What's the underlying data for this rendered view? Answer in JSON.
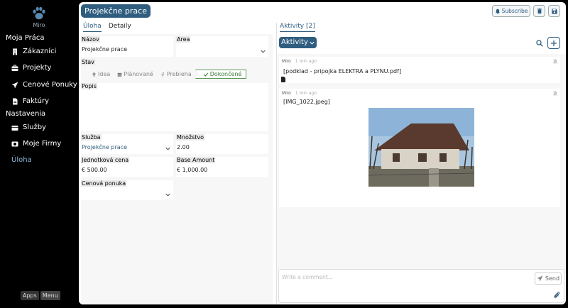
{
  "sidebar": {
    "user": "Miro",
    "section1": "Moja Práca",
    "items1": [
      {
        "label": "Zákazníci",
        "icon": "building-icon"
      },
      {
        "label": "Projekty",
        "icon": "briefcase-icon"
      },
      {
        "label": "Cenové Ponuky",
        "icon": "send-icon"
      },
      {
        "label": "Faktúry",
        "icon": "file-icon"
      }
    ],
    "section2": "Nastavenia",
    "items2": [
      {
        "label": "Služby",
        "icon": "box-icon"
      },
      {
        "label": "Moje Firmy",
        "icon": "id-card-icon"
      },
      {
        "label": "Úloha",
        "icon": ""
      }
    ],
    "apps": "Apps",
    "menu": "Menu"
  },
  "header": {
    "title": "Projekčne prace",
    "subscribe": "Subscribe"
  },
  "tabs": {
    "uloha": "Úloha",
    "detaily": "Detaily"
  },
  "form": {
    "nazov_label": "Názov",
    "nazov_value": "Projekčne prace",
    "area_label": "Area",
    "stav_label": "Stav",
    "states": [
      "Idea",
      "Plánované",
      "Prebieha",
      "Dokončené"
    ],
    "popis_label": "Popis",
    "sluzba_label": "Služba",
    "sluzba_value": "Projekčne prace",
    "mnozstvo_label": "Množstvo",
    "mnozstvo_value": "2.00",
    "cena_label": "Jednotková cena",
    "cena_value": "€ 500.00",
    "base_label": "Base Amount",
    "base_value": "€ 1,000.00",
    "ponuka_label": "Cenová ponuka"
  },
  "activity": {
    "tab": "Aktivity [2]",
    "filter": "Aktivity",
    "items": [
      {
        "author": "Miro",
        "time": "1 min ago",
        "text": "[podklad  - pripojka ELEKTRA a PLYNU.pdf]"
      },
      {
        "author": "Miro",
        "time": "1 min ago",
        "text": "[IMG_1022.jpeg]"
      }
    ],
    "comment_placeholder": "Write a comment...",
    "send": "Send"
  },
  "colors": {
    "accent": "#2f5d80",
    "done": "#3a7a3a"
  }
}
